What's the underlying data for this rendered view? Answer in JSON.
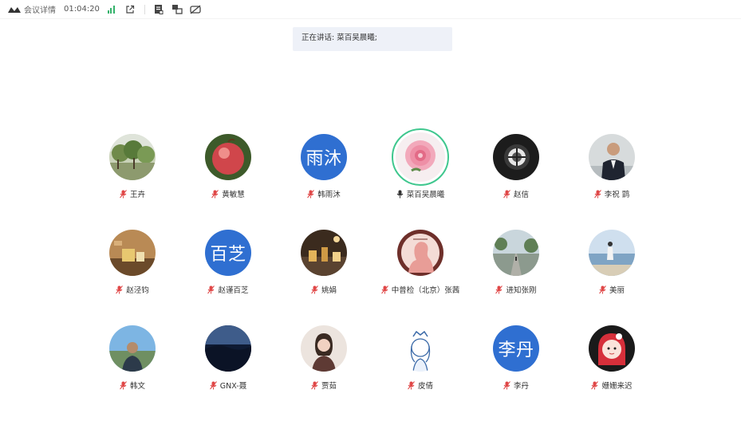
{
  "toolbar": {
    "title": "会议详情",
    "timer": "01:04:20",
    "icons": [
      "meeting-logo-icon",
      "signal-icon",
      "share-out-icon",
      "notes-icon",
      "layout-switch-icon",
      "hide-video-icon"
    ],
    "signal_color": "#34b26b"
  },
  "speaking": {
    "text": "正在讲话: 菜百吴晨曦;"
  },
  "participants": [
    {
      "name": "王卉",
      "avatar": "photo-orchard",
      "muted": true
    },
    {
      "name": "黄敏慧",
      "avatar": "photo-apple",
      "muted": true
    },
    {
      "name": "韩雨沐",
      "avatar_text": "雨沐",
      "muted": true
    },
    {
      "name": "菜百吴晨曦",
      "avatar": "photo-peony",
      "muted": false,
      "speaking": true
    },
    {
      "name": "赵信",
      "avatar": "photo-camera-lens",
      "muted": true
    },
    {
      "name": "李祝 鹍",
      "avatar": "photo-man-suit",
      "muted": true
    },
    {
      "name": "赵泾钧",
      "avatar": "photo-tea",
      "muted": true
    },
    {
      "name": "赵谨百芝",
      "avatar_text": "百芝",
      "muted": true
    },
    {
      "name": "姚娟",
      "avatar": "photo-cafe",
      "muted": true
    },
    {
      "name": "中普检（北京）张茜",
      "avatar": "photo-silhouette",
      "muted": true
    },
    {
      "name": "进知张刚",
      "avatar": "photo-road",
      "muted": true
    },
    {
      "name": "美丽",
      "avatar": "photo-beach",
      "muted": true
    },
    {
      "name": "韩文",
      "avatar": "photo-man-outdoor",
      "muted": true
    },
    {
      "name": "GNX-聂",
      "avatar": "photo-mountain",
      "muted": true
    },
    {
      "name": "贾茹",
      "avatar": "photo-woman",
      "muted": true
    },
    {
      "name": "皮倩",
      "avatar": "photo-cartoon-girl",
      "muted": true
    },
    {
      "name": "李丹",
      "avatar_text": "李丹",
      "muted": true
    },
    {
      "name": "姗姗来迟",
      "avatar": "photo-cartoon-red",
      "muted": true
    }
  ],
  "colors": {
    "text_avatar_bg": "#2f6fd1",
    "muted_mic": "#e04848",
    "speaking_ring": "#3fc78e"
  }
}
